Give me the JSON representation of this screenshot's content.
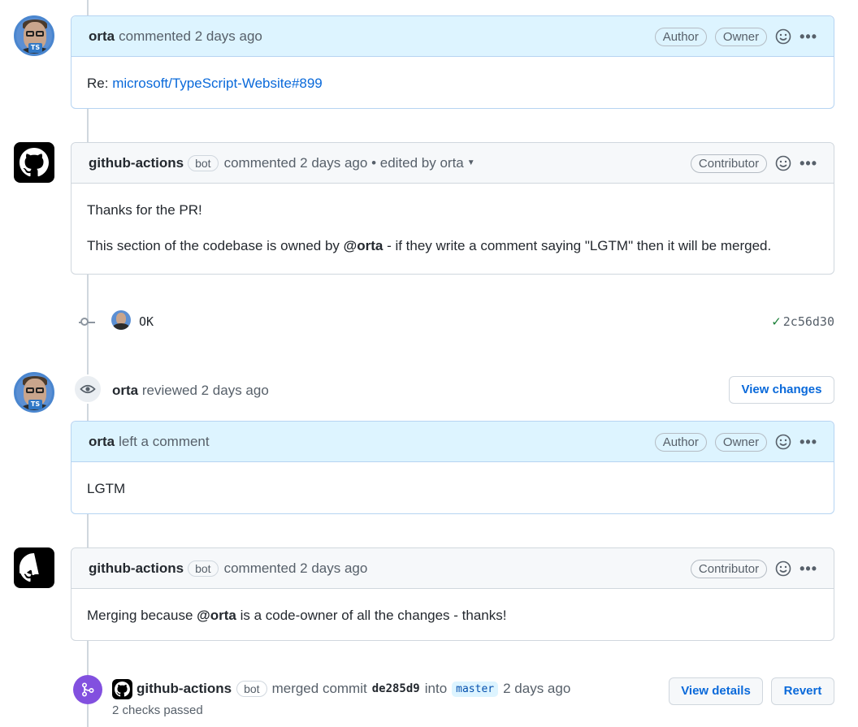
{
  "comment1": {
    "author": "orta",
    "action": "commented",
    "time": "2 days ago",
    "badges": [
      "Author",
      "Owner"
    ],
    "body_prefix": "Re: ",
    "body_link": "microsoft/TypeScript-Website#899"
  },
  "comment2": {
    "author": "github-actions",
    "bot_label": "bot",
    "action": "commented",
    "time": "2 days ago",
    "edited": "• edited by orta",
    "badge": "Contributor",
    "line1": "Thanks for the PR!",
    "line2_pre": "This section of the codebase is owned by ",
    "line2_mention": "@orta",
    "line2_post": " - if they write a comment saying \"LGTM\" then it will be merged."
  },
  "commit": {
    "message": "OK",
    "sha": "2c56d30"
  },
  "review": {
    "author": "orta",
    "action": "reviewed 2 days ago",
    "view_changes_label": "View changes"
  },
  "comment3": {
    "author": "orta",
    "action": "left a comment",
    "badges": [
      "Author",
      "Owner"
    ],
    "body": "LGTM"
  },
  "comment4": {
    "author": "github-actions",
    "bot_label": "bot",
    "action": "commented",
    "time": "2 days ago",
    "badge": "Contributor",
    "body_pre": "Merging because ",
    "body_mention": "@orta",
    "body_post": " is a code-owner of all the changes - thanks!"
  },
  "merge": {
    "author": "github-actions",
    "bot_label": "bot",
    "action": "merged commit",
    "commit_id": "de285d9",
    "into": "into",
    "branch": "master",
    "time": "2 days ago",
    "checks": "2 checks passed",
    "view_details_label": "View details",
    "revert_label": "Revert"
  },
  "colors": {
    "link": "#0969da",
    "owner_header": "#ddf4ff",
    "merged": "#8250df",
    "success": "#1a7f37"
  }
}
